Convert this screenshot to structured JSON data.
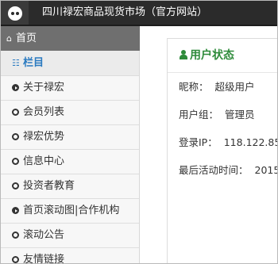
{
  "header": {
    "site_title": "四川禄宏商品现货市场（官方网站）"
  },
  "sidebar": {
    "home_label": "首页",
    "columns_label": "栏目",
    "items": [
      {
        "label": "关于禄宏",
        "bullet": "filled"
      },
      {
        "label": "会员列表",
        "bullet": "hollow"
      },
      {
        "label": "禄宏优势",
        "bullet": "hollow"
      },
      {
        "label": "信息中心",
        "bullet": "hollow"
      },
      {
        "label": "投资者教育",
        "bullet": "hollow"
      },
      {
        "label": "首页滚动图|合作机构",
        "bullet": "filled"
      },
      {
        "label": "滚动公告",
        "bullet": "hollow"
      },
      {
        "label": "友情链接",
        "bullet": "hollow"
      }
    ]
  },
  "panel": {
    "title": "用户状态",
    "rows": [
      {
        "label": "昵称：",
        "value": "超级用户"
      },
      {
        "label": "用户组：",
        "value": "管理员"
      },
      {
        "label": "登录IP：",
        "value": "118.122.85."
      },
      {
        "label": "最后活动时间：",
        "value": "2015"
      }
    ]
  },
  "colors": {
    "topbar": "#2b2b2b",
    "home_active": "#6f6f6f",
    "columns_accent": "#2a7ac0",
    "panel_title": "#2e8b3a"
  }
}
